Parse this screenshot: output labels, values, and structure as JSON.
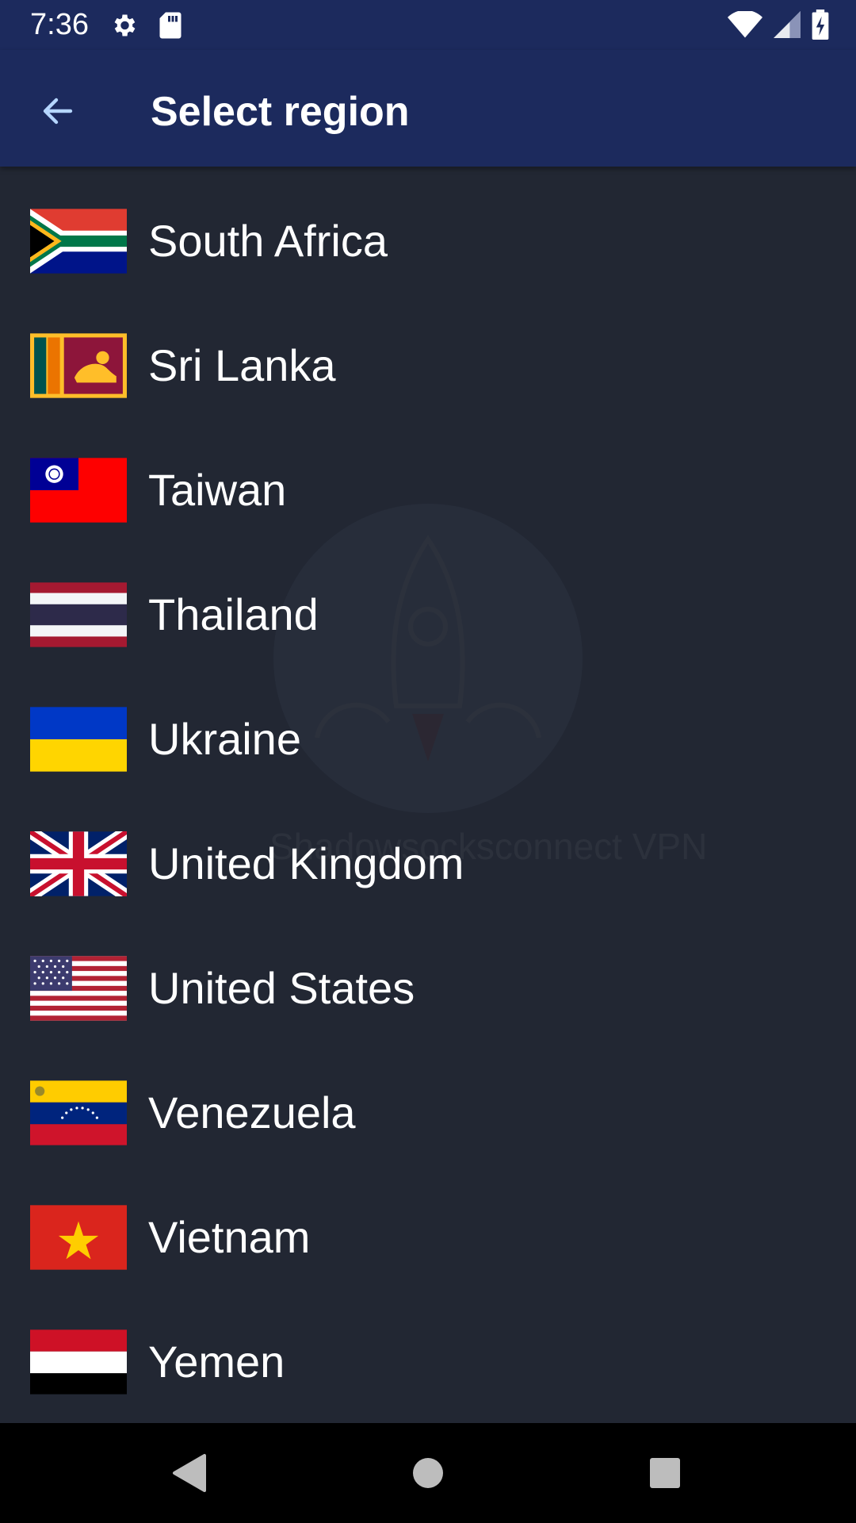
{
  "status_bar": {
    "time": "7:36",
    "left_icons": [
      "settings-icon",
      "sd-card-icon"
    ],
    "right_icons": [
      "wifi-icon",
      "signal-icon",
      "battery-charging-icon"
    ]
  },
  "app_bar": {
    "title": "Select region",
    "back_icon": "arrow-back-icon",
    "background": "#1c2a5d"
  },
  "watermark": {
    "text": "Shadowsocksconnect VPN",
    "icon": "rocket-icon"
  },
  "regions": [
    {
      "name": "South Africa",
      "flag": "flag-za-icon"
    },
    {
      "name": "Sri Lanka",
      "flag": "flag-lk-icon"
    },
    {
      "name": "Taiwan",
      "flag": "flag-tw-icon"
    },
    {
      "name": "Thailand",
      "flag": "flag-th-icon"
    },
    {
      "name": "Ukraine",
      "flag": "flag-ua-icon"
    },
    {
      "name": "United Kingdom",
      "flag": "flag-gb-icon"
    },
    {
      "name": "United States",
      "flag": "flag-us-icon"
    },
    {
      "name": "Venezuela",
      "flag": "flag-ve-icon"
    },
    {
      "name": "Vietnam",
      "flag": "flag-vn-icon"
    },
    {
      "name": "Yemen",
      "flag": "flag-ye-icon"
    }
  ],
  "nav_bar": {
    "buttons": [
      "back-triangle-icon",
      "home-circle-icon",
      "recents-square-icon"
    ]
  },
  "colors": {
    "background": "#222733",
    "header": "#1c2a5d",
    "text": "#ffffff"
  }
}
